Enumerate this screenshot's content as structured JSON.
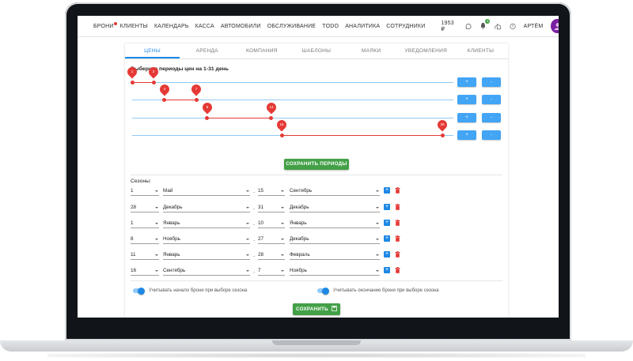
{
  "nav": {
    "items": [
      "БРОНИ",
      "КЛИЕНТЫ",
      "КАЛЕНДАРЬ",
      "КАССА",
      "АВТОМОБИЛИ",
      "ОБСЛУЖИВАНИЕ",
      "TODO",
      "АНАЛИТИКА",
      "СОТРУДНИКИ"
    ],
    "balance": "1953 ₽",
    "notifications_count": "8",
    "user_name": "АРТЁМ"
  },
  "tabs": [
    "ЦЕНЫ",
    "АРЕНДА",
    "КОМПАНИЯ",
    "ШАБЛОНЫ",
    "МАЯКИ",
    "УВЕДОМЛЕНИЯ",
    "КЛИЕНТЫ"
  ],
  "active_tab": 0,
  "periods": {
    "title": "Выберите периоды цен на 1-31 день",
    "day_min": 1,
    "day_max": 31,
    "rows": [
      {
        "from": "1",
        "to": "3"
      },
      {
        "from": "4",
        "to": "7"
      },
      {
        "from": "8",
        "to": "14"
      },
      {
        "from": "15",
        "to": "30"
      }
    ],
    "add_label": "+",
    "remove_label": "-",
    "save_label": "СОХРАНИТЬ ПЕРИОДЫ"
  },
  "seasons": {
    "title": "Сезоны:",
    "separator": "-",
    "rows": [
      {
        "start_day": "1",
        "start_month": "Май",
        "end_day": "15",
        "end_month": "Сентябрь"
      },
      {
        "start_day": "28",
        "start_month": "Декабрь",
        "end_day": "31",
        "end_month": "Декабрь"
      },
      {
        "start_day": "1",
        "start_month": "Январь",
        "end_day": "10",
        "end_month": "Январь"
      },
      {
        "start_day": "8",
        "start_month": "Ноябрь",
        "end_day": "27",
        "end_month": "Декабрь"
      },
      {
        "start_day": "11",
        "start_month": "Январь",
        "end_day": "28",
        "end_month": "Февраль"
      },
      {
        "start_day": "16",
        "start_month": "Сентябрь",
        "end_day": "7",
        "end_month": "Ноябрь"
      }
    ],
    "add_label": "+"
  },
  "options": {
    "start_toggle_label": "Учитывать начало брони при выборе сезона",
    "end_toggle_label": "Учитывать окончание брони при выборе сезона"
  },
  "save_label": "СОХРАНИТЬ",
  "colors": {
    "accent": "#1e88e5",
    "danger": "#e53935",
    "success": "#43a047",
    "track": "#90caf9"
  },
  "icons": [
    "menu-icon",
    "whatsapp-icon",
    "bell-icon",
    "building-icon",
    "help-icon",
    "avatar-icon",
    "trash-icon",
    "save-icon"
  ]
}
